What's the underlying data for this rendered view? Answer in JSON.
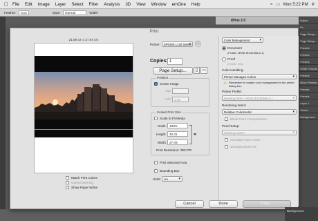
{
  "menubar": {
    "items": [
      "File",
      "Edit",
      "Image",
      "Layer",
      "Select",
      "Filter",
      "Analysis",
      "3D",
      "View",
      "Window",
      "emOne",
      "Help"
    ],
    "clock": "Mon 5:22 PM"
  },
  "optbar": {
    "feather_label": "Feather:",
    "feather_value": "0 px",
    "style_label": "Style:",
    "style_value": "Normal",
    "width_label": "Width:"
  },
  "file_panel_title": "Øfine 2.0",
  "right_panel": {
    "items": [
      "Adjust",
      "Ps",
      "Page Setup...",
      "Page Setup...",
      "Presets",
      "Presets",
      "Presets",
      "White Presets",
      "Presets",
      "Mixer Presets",
      "Presets",
      "Presets",
      "Layer 1",
      "Stroke",
      "Background"
    ]
  },
  "dialog": {
    "title": "Print",
    "paper_size_caption": "21.59 cm x 27.94 cm",
    "printer_label": "Printer:",
    "printer_value": "EPSON L120 Series",
    "copies_label": "Copies:",
    "copies_value": "1",
    "page_setup_button": "Page Setup...",
    "position": {
      "title": "Position",
      "center_image": "Center Image",
      "top_label": "Top:",
      "top_value": "",
      "left_label": "Left:",
      "left_value": "1.93"
    },
    "scaled": {
      "title": "Scaled Print Size",
      "scale_to_fit": "Scale to Fit Media",
      "scale_label": "Scale:",
      "scale_value": "100%",
      "height_label": "Height:",
      "height_value": "20.31",
      "width_label": "Width:",
      "width_value": "27.09",
      "resolution": "Print Resolution: 300 PPI"
    },
    "print_selected_area": "Print Selected Area",
    "bounding_box": "Bounding Box",
    "units_label": "Units:",
    "units_value": "cm",
    "match_print_colors": "Match Print Colors",
    "gamut_warning": "Gamut Warning",
    "show_paper_white": "Show Paper White",
    "color_management": {
      "header": "Color Management",
      "document": "Document",
      "document_profile": "(Profile: sRGB IEC61966-2.1)",
      "proof": "Proof",
      "proof_profile": "(Profile: N/A)",
      "color_handling_label": "Color Handling:",
      "color_handling_value": "Printer Manages Colors",
      "note": "Remember to enable color management in the printer dialog box.",
      "printer_profile_label": "Printer Profile:",
      "printer_profile_value": "Working RGB - sRGB IEC61966-2.1",
      "rendering_intent_label": "Rendering Intent:",
      "rendering_intent_value": "Relative Colorimetric",
      "black_point": "Black Point Compensation",
      "proof_setup_label": "Proof Setup:",
      "proof_setup_value": "Working CMYK",
      "simulate_paper": "Simulate Paper Color",
      "simulate_black": "Simulate Black Ink"
    },
    "buttons": {
      "cancel": "Cancel",
      "done": "Done",
      "print": "Print..."
    }
  }
}
